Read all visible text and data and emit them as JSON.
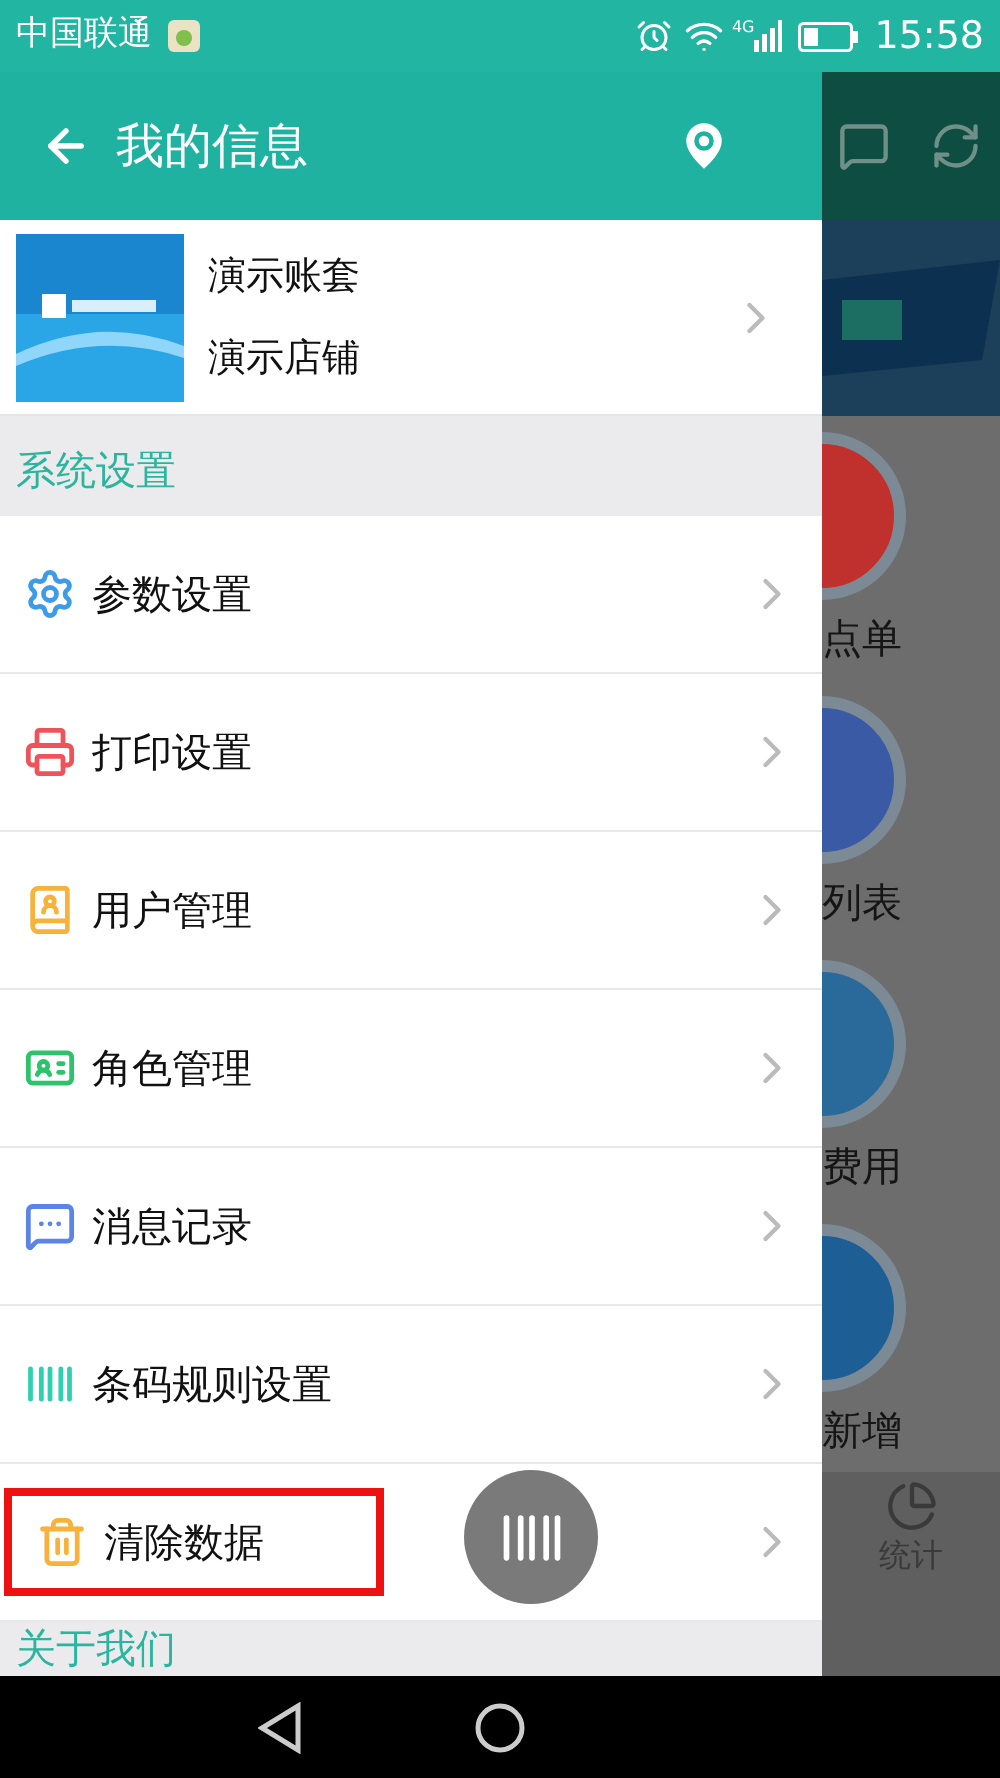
{
  "status_bar": {
    "carrier": "中国联通",
    "network": "4G",
    "time": "15:58"
  },
  "header": {
    "title": "我的信息"
  },
  "profile": {
    "account": "演示账套",
    "store": "演示店铺"
  },
  "sections": [
    {
      "title": "系统设置",
      "items": [
        {
          "label": "参数设置",
          "kind": "gear",
          "highlighted": false
        },
        {
          "label": "打印设置",
          "kind": "printer",
          "highlighted": false
        },
        {
          "label": "用户管理",
          "kind": "contacts",
          "highlighted": false
        },
        {
          "label": "角色管理",
          "kind": "badge",
          "highlighted": false
        },
        {
          "label": "消息记录",
          "kind": "message",
          "highlighted": false
        },
        {
          "label": "条码规则设置",
          "kind": "barcode",
          "highlighted": false
        },
        {
          "label": "清除数据",
          "kind": "trash",
          "highlighted": true
        }
      ]
    },
    {
      "title": "关于我们"
    }
  ],
  "background_app": {
    "tiles": [
      {
        "label": "点单",
        "color": "#c0302c"
      },
      {
        "label": "列表",
        "color": "#3b5aa6"
      },
      {
        "label": "费用",
        "color": "#2a6a9a"
      },
      {
        "label": "新增",
        "color": "#1d5f95"
      }
    ],
    "tab_label": "统计"
  }
}
